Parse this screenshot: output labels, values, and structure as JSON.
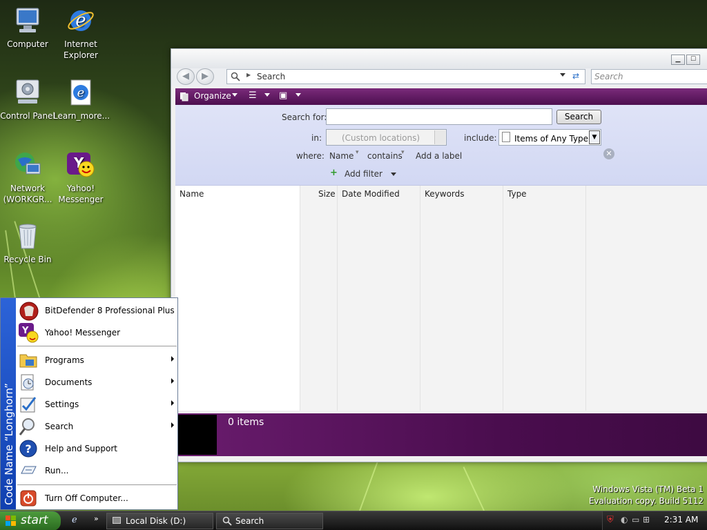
{
  "desktop": {
    "icons": [
      {
        "label": "Computer"
      },
      {
        "label": "Internet Explorer"
      },
      {
        "label": "Control Panel"
      },
      {
        "label": "Learn_more..."
      },
      {
        "label": "Network (WORKGR..."
      },
      {
        "label": "Yahoo! Messenger"
      },
      {
        "label": "Recycle Bin"
      }
    ],
    "watermark": {
      "line1": "Windows Vista (TM) Beta 1",
      "line2": "Evaluation copy. Build 5112"
    }
  },
  "explorer": {
    "address": "Search",
    "search_placeholder": "Search",
    "toolbar": {
      "organize": "Organize"
    },
    "search_pane": {
      "search_for_label": "Search for:",
      "search_button": "Search",
      "in_label": "in:",
      "in_value": "(Custom locations)",
      "include_label": "include:",
      "include_value": "Items of Any Type",
      "where_label": "where:",
      "where_field": "Name",
      "where_op": "contains",
      "add_label": "Add a label",
      "add_filter": "Add filter"
    },
    "columns": [
      "Name",
      "Size",
      "Date Modified",
      "Keywords",
      "Type"
    ],
    "status": "0 items"
  },
  "start_menu": {
    "sidebar_text": "Code Name “Longhorn”",
    "pinned": [
      {
        "label": "BitDefender 8 Professional Plus"
      },
      {
        "label": "Yahoo! Messenger"
      }
    ],
    "items": [
      {
        "label": "Programs"
      },
      {
        "label": "Documents"
      },
      {
        "label": "Settings"
      },
      {
        "label": "Search"
      },
      {
        "label": "Help and Support"
      },
      {
        "label": "Run..."
      }
    ],
    "turn_off": "Turn Off Computer..."
  },
  "taskbar": {
    "start_label": "start",
    "tasks": [
      {
        "label": "Local Disk (D:)"
      },
      {
        "label": "Search"
      }
    ],
    "clock": "2:31 AM"
  },
  "colors": {
    "accent": "#5a145d",
    "search_pane": "#d9ddf5",
    "start_sidebar": "#1f55c8",
    "start_button": "#3c8a30"
  }
}
